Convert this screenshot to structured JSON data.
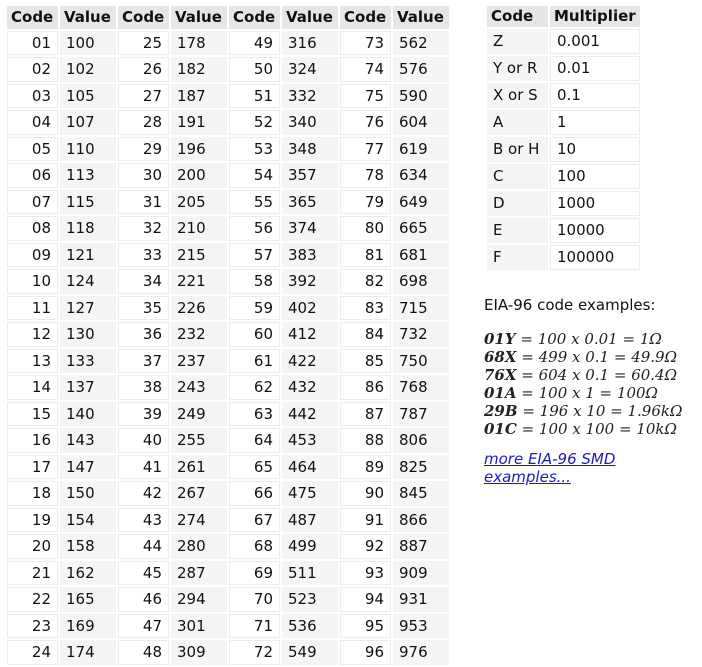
{
  "table_headers": {
    "code": "Code",
    "value": "Value"
  },
  "rows": [
    [
      [
        "01",
        "100"
      ],
      [
        "25",
        "178"
      ],
      [
        "49",
        "316"
      ],
      [
        "73",
        "562"
      ]
    ],
    [
      [
        "02",
        "102"
      ],
      [
        "26",
        "182"
      ],
      [
        "50",
        "324"
      ],
      [
        "74",
        "576"
      ]
    ],
    [
      [
        "03",
        "105"
      ],
      [
        "27",
        "187"
      ],
      [
        "51",
        "332"
      ],
      [
        "75",
        "590"
      ]
    ],
    [
      [
        "04",
        "107"
      ],
      [
        "28",
        "191"
      ],
      [
        "52",
        "340"
      ],
      [
        "76",
        "604"
      ]
    ],
    [
      [
        "05",
        "110"
      ],
      [
        "29",
        "196"
      ],
      [
        "53",
        "348"
      ],
      [
        "77",
        "619"
      ]
    ],
    [
      [
        "06",
        "113"
      ],
      [
        "30",
        "200"
      ],
      [
        "54",
        "357"
      ],
      [
        "78",
        "634"
      ]
    ],
    [
      [
        "07",
        "115"
      ],
      [
        "31",
        "205"
      ],
      [
        "55",
        "365"
      ],
      [
        "79",
        "649"
      ]
    ],
    [
      [
        "08",
        "118"
      ],
      [
        "32",
        "210"
      ],
      [
        "56",
        "374"
      ],
      [
        "80",
        "665"
      ]
    ],
    [
      [
        "09",
        "121"
      ],
      [
        "33",
        "215"
      ],
      [
        "57",
        "383"
      ],
      [
        "81",
        "681"
      ]
    ],
    [
      [
        "10",
        "124"
      ],
      [
        "34",
        "221"
      ],
      [
        "58",
        "392"
      ],
      [
        "82",
        "698"
      ]
    ],
    [
      [
        "11",
        "127"
      ],
      [
        "35",
        "226"
      ],
      [
        "59",
        "402"
      ],
      [
        "83",
        "715"
      ]
    ],
    [
      [
        "12",
        "130"
      ],
      [
        "36",
        "232"
      ],
      [
        "60",
        "412"
      ],
      [
        "84",
        "732"
      ]
    ],
    [
      [
        "13",
        "133"
      ],
      [
        "37",
        "237"
      ],
      [
        "61",
        "422"
      ],
      [
        "85",
        "750"
      ]
    ],
    [
      [
        "14",
        "137"
      ],
      [
        "38",
        "243"
      ],
      [
        "62",
        "432"
      ],
      [
        "86",
        "768"
      ]
    ],
    [
      [
        "15",
        "140"
      ],
      [
        "39",
        "249"
      ],
      [
        "63",
        "442"
      ],
      [
        "87",
        "787"
      ]
    ],
    [
      [
        "16",
        "143"
      ],
      [
        "40",
        "255"
      ],
      [
        "64",
        "453"
      ],
      [
        "88",
        "806"
      ]
    ],
    [
      [
        "17",
        "147"
      ],
      [
        "41",
        "261"
      ],
      [
        "65",
        "464"
      ],
      [
        "89",
        "825"
      ]
    ],
    [
      [
        "18",
        "150"
      ],
      [
        "42",
        "267"
      ],
      [
        "66",
        "475"
      ],
      [
        "90",
        "845"
      ]
    ],
    [
      [
        "19",
        "154"
      ],
      [
        "43",
        "274"
      ],
      [
        "67",
        "487"
      ],
      [
        "91",
        "866"
      ]
    ],
    [
      [
        "20",
        "158"
      ],
      [
        "44",
        "280"
      ],
      [
        "68",
        "499"
      ],
      [
        "92",
        "887"
      ]
    ],
    [
      [
        "21",
        "162"
      ],
      [
        "45",
        "287"
      ],
      [
        "69",
        "511"
      ],
      [
        "93",
        "909"
      ]
    ],
    [
      [
        "22",
        "165"
      ],
      [
        "46",
        "294"
      ],
      [
        "70",
        "523"
      ],
      [
        "94",
        "931"
      ]
    ],
    [
      [
        "23",
        "169"
      ],
      [
        "47",
        "301"
      ],
      [
        "71",
        "536"
      ],
      [
        "95",
        "953"
      ]
    ],
    [
      [
        "24",
        "174"
      ],
      [
        "48",
        "309"
      ],
      [
        "72",
        "549"
      ],
      [
        "96",
        "976"
      ]
    ]
  ],
  "multiplier_table": {
    "headers": {
      "code": "Code",
      "multiplier": "Multiplier"
    },
    "rows": [
      {
        "code": "Z",
        "multiplier": "0.001"
      },
      {
        "code": "Y or R",
        "multiplier": "0.01"
      },
      {
        "code": "X or S",
        "multiplier": "0.1"
      },
      {
        "code": "A",
        "multiplier": "1"
      },
      {
        "code": "B or H",
        "multiplier": "10"
      },
      {
        "code": "C",
        "multiplier": "100"
      },
      {
        "code": "D",
        "multiplier": "1000"
      },
      {
        "code": "E",
        "multiplier": "10000"
      },
      {
        "code": "F",
        "multiplier": "100000"
      }
    ]
  },
  "examples": {
    "heading": "EIA-96 code examples:",
    "items": [
      {
        "code": "01Y",
        "formula": " = 100 x 0.01 = 1Ω"
      },
      {
        "code": "68X",
        "formula": " = 499 x 0.1 = 49.9Ω"
      },
      {
        "code": "76X",
        "formula": " = 604 x 0.1 = 60.4Ω"
      },
      {
        "code": "01A",
        "formula": " = 100 x 1 = 100Ω"
      },
      {
        "code": "29B",
        "formula": " = 196 x 10 = 1.96kΩ"
      },
      {
        "code": "01C",
        "formula": " = 100 x 100 = 10kΩ"
      }
    ],
    "link_text": "more EIA-96 SMD examples..."
  }
}
